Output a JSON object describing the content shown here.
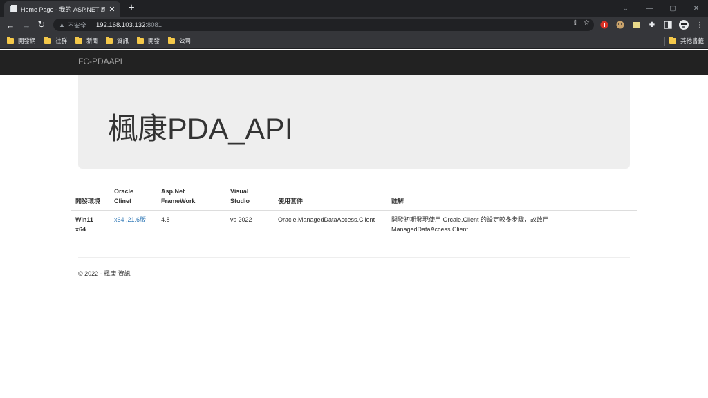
{
  "browser": {
    "tab_title": "Home Page - 我的 ASP.NET 應用",
    "address": {
      "insecure_label": "不安全",
      "host": "192.168.103.132",
      "port": ":8081"
    },
    "bookmarks": [
      {
        "label": "開發網"
      },
      {
        "label": "社群"
      },
      {
        "label": "新聞"
      },
      {
        "label": "資訊"
      },
      {
        "label": "開發"
      },
      {
        "label": "公司"
      }
    ],
    "other_bookmarks": "其他書籤"
  },
  "site": {
    "brand": "FC-PDAAPI",
    "jumbotron_title": "楓康PDA_API"
  },
  "table": {
    "headers": [
      {
        "line1": "",
        "line2": "開發環境"
      },
      {
        "line1": "Oracle",
        "line2": "Clinet"
      },
      {
        "line1": "Asp.Net",
        "line2": "FrameWork"
      },
      {
        "line1": "Visual",
        "line2": "Studio"
      },
      {
        "line1": "",
        "line2": "使用套件"
      },
      {
        "line1": "",
        "line2": "註解"
      }
    ],
    "row": {
      "env_line1": "Win11",
      "env_line2": "x64",
      "oracle_client": "x64 ,21.6版",
      "framework": "4.8",
      "visual_studio": "vs 2022",
      "package": "Oracle.ManagedDataAccess.Client",
      "note_line1": "開發初期發現使用 Orcale.Client 的設定較多步驟，故改用",
      "note_line2": "ManagedDataAccess.Client"
    }
  },
  "footer": {
    "text": "© 2022 - 楓康 資訊"
  }
}
